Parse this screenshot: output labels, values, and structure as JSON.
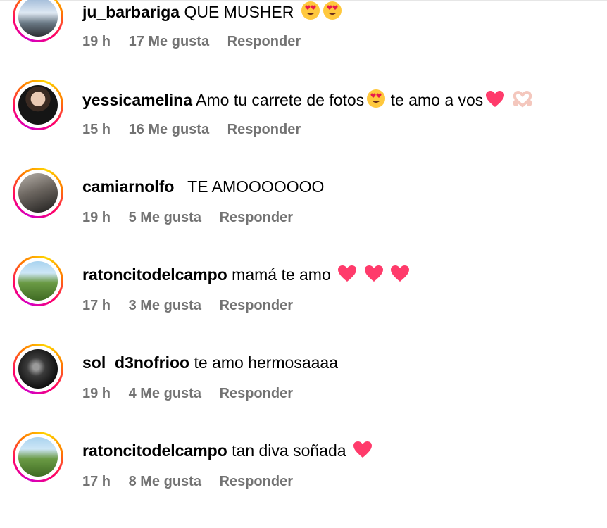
{
  "comments": [
    {
      "username": "ju_barbariga",
      "text": "QUE MUSHER",
      "emojis": [
        "heart-eyes-emoji",
        "heart-eyes-emoji"
      ],
      "time": "19 h",
      "likes": "17 Me gusta",
      "reply": "Responder"
    },
    {
      "username": "yessicamelina",
      "text": "Amo tu carrete de fotos",
      "emojis_mid": [
        "heart-eyes-emoji"
      ],
      "text2": "te amo a vos",
      "emojis": [
        "pink-heart-emoji",
        "heart-hands-emoji"
      ],
      "time": "15 h",
      "likes": "16 Me gusta",
      "reply": "Responder"
    },
    {
      "username": "camiarnolfo_",
      "text": "TE AMOOOOOOO",
      "emojis": [],
      "time": "19 h",
      "likes": "5 Me gusta",
      "reply": "Responder"
    },
    {
      "username": "ratoncitodelcampo",
      "text": "mamá te amo",
      "emojis": [
        "pink-heart-emoji",
        "pink-heart-emoji",
        "pink-heart-emoji"
      ],
      "time": "17 h",
      "likes": "3 Me gusta",
      "reply": "Responder"
    },
    {
      "username": "sol_d3nofrioo",
      "text": "te amo hermosaaaa",
      "emojis": [],
      "time": "19 h",
      "likes": "4 Me gusta",
      "reply": "Responder"
    },
    {
      "username": "ratoncitodelcampo",
      "text": "tan diva soñada",
      "emojis": [
        "pink-heart-emoji"
      ],
      "time": "17 h",
      "likes": "8 Me gusta",
      "reply": "Responder"
    }
  ],
  "colors": {
    "meta": "#737373",
    "heart": "#ff3b6b",
    "ring_start": "#d300c5",
    "ring_end": "#ffd600"
  }
}
